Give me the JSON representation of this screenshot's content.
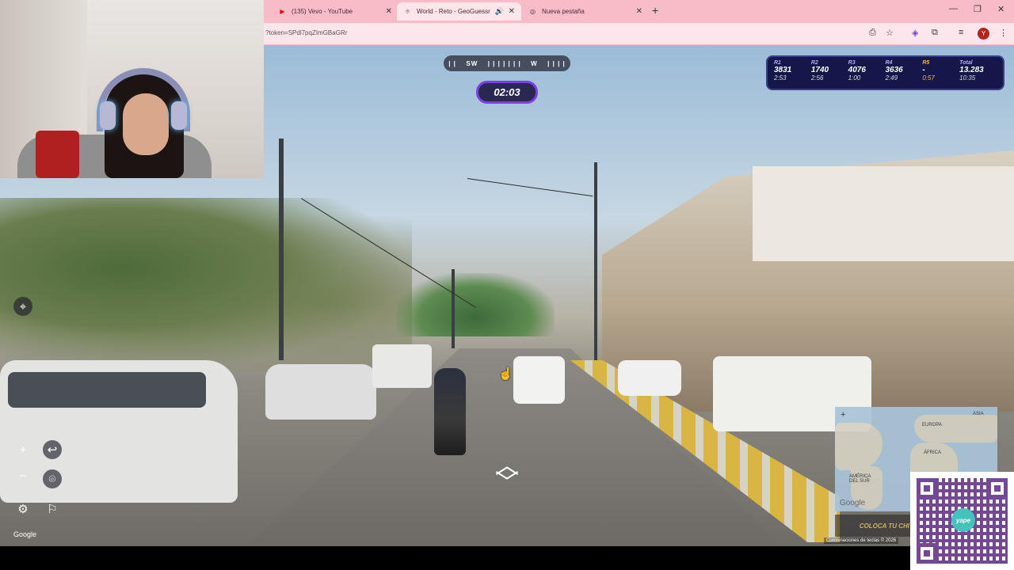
{
  "browser": {
    "tabs": [
      {
        "label": "(135) Vevo - YouTube",
        "icon": "youtube-icon",
        "active": false
      },
      {
        "label": "World - Reto - GeoGuessr",
        "icon": "map-pin-icon",
        "active": true
      },
      {
        "label": "Nueva pestaña",
        "icon": "chrome-icon",
        "active": false
      }
    ],
    "url": "?token=SPdl7pqZImGBaGRr",
    "avatar_letter": "Y"
  },
  "game": {
    "compass": [
      "SW",
      "W"
    ],
    "timer": "02:03",
    "rounds": [
      {
        "label": "R1",
        "points": "3831",
        "time": "2:53"
      },
      {
        "label": "R2",
        "points": "1740",
        "time": "2:56"
      },
      {
        "label": "R3",
        "points": "4076",
        "time": "1:00"
      },
      {
        "label": "R4",
        "points": "3636",
        "time": "2:49"
      },
      {
        "label": "R5",
        "points": "-",
        "time": "0:57"
      }
    ],
    "total": {
      "label": "Total",
      "points": "13.283",
      "time": "10:35"
    },
    "minimap": {
      "labels": [
        "ASIA",
        "EUROPA",
        "ÁFRICA",
        "AMÉRICA DEL SUR"
      ],
      "google": "Google",
      "guess_button": "COLOCA TU CHI"
    },
    "footer": "Combinaciones de teclas  © 2026",
    "google_logo": "Google"
  },
  "overlay": {
    "qr_logo": "yape"
  },
  "colors": {
    "chrome": "#f8bcc8",
    "timer_border": "#7b3fe4",
    "scoreboard": "#15174a",
    "current_round": "#f5b530"
  }
}
